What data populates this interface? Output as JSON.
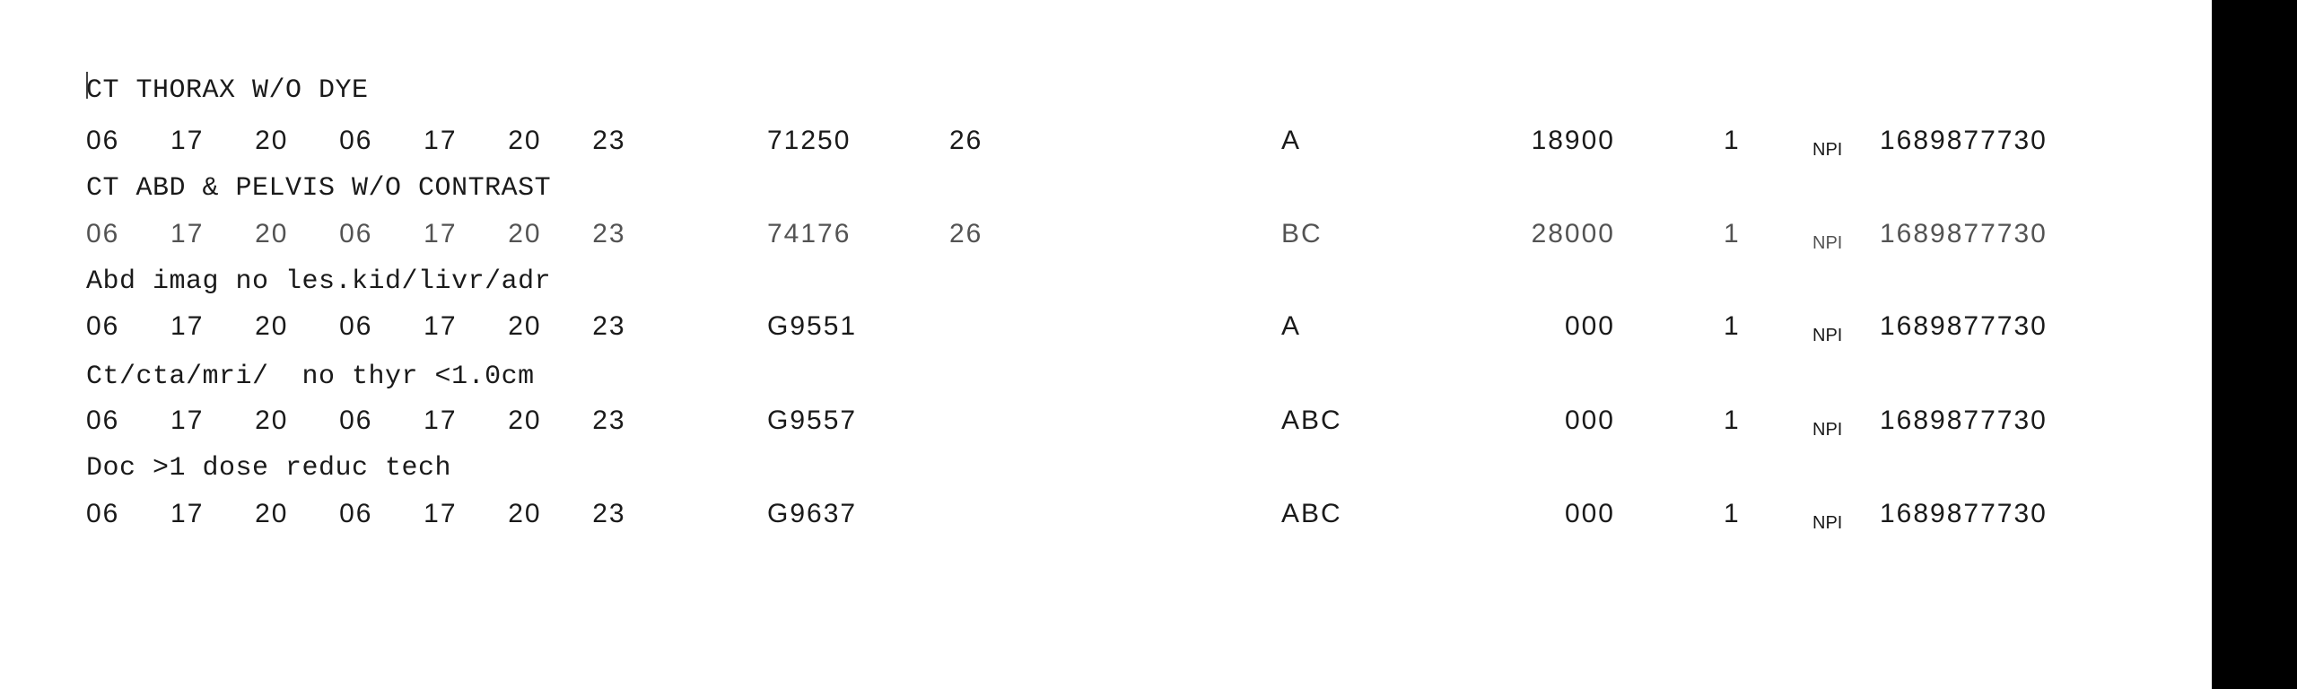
{
  "lines": [
    {
      "description": "CT THORAX W/O DYE",
      "dates": "06  17  20  06  17  20  23",
      "code": "71250",
      "modifier": "26",
      "pointer": "A",
      "charges": "18900",
      "units": "1",
      "id_qual": "NPI",
      "npi": "1689877730"
    },
    {
      "description": "CT ABD & PELVIS W/O CONTRAST",
      "dates": "06  17  20  06  17  20  23",
      "code": "74176",
      "modifier": "26",
      "pointer": "BC",
      "charges": "28000",
      "units": "1",
      "id_qual": "NPI",
      "npi": "1689877730"
    },
    {
      "description": "Abd imag no les.kid/livr/adr",
      "dates": "06  17  20  06  17  20  23",
      "code": "G9551",
      "modifier": "",
      "pointer": "A",
      "charges": "000",
      "units": "1",
      "id_qual": "NPI",
      "npi": "1689877730"
    },
    {
      "description": "Ct/cta/mri/  no thyr <1.0cm",
      "dates": "06  17  20  06  17  20  23",
      "code": "G9557",
      "modifier": "",
      "pointer": "ABC",
      "charges": "000",
      "units": "1",
      "id_qual": "NPI",
      "npi": "1689877730"
    },
    {
      "description": "Doc >1 dose reduc tech",
      "dates": "06  17  20  06  17  20  23",
      "code": "G9637",
      "modifier": "",
      "pointer": "ABC",
      "charges": "000",
      "units": "1",
      "id_qual": "NPI",
      "npi": "1689877730"
    }
  ]
}
